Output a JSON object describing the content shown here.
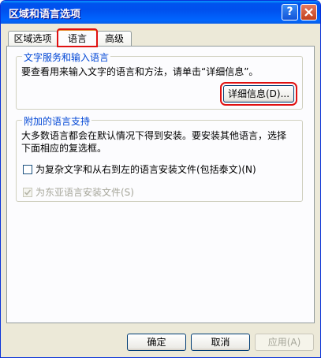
{
  "window": {
    "title": "区域和语言选项"
  },
  "titlebar": {
    "help_symbol": "?"
  },
  "tabs": [
    {
      "label": "区域选项"
    },
    {
      "label": "语言",
      "selected": true
    },
    {
      "label": "高级"
    }
  ],
  "text_services": {
    "legend": "文字服务和输入语言",
    "description": "要查看用来输入文字的语言和方法，请单击“详细信息”。",
    "details_button": "详细信息(D)..."
  },
  "supplemental": {
    "legend": "附加的语言支持",
    "description_line1": "大多数语言都会在默认情况下得到安装。要安装其他语言，选择",
    "description_line2": "下面相应的复选框。",
    "checkbox_complex": {
      "label": "为复杂文字和从右到左的语言安装文件(包括泰文)(N)",
      "checked": false,
      "enabled": true
    },
    "checkbox_east_asian": {
      "label": "为东亚语言安装文件(S)",
      "checked": true,
      "enabled": false
    }
  },
  "footer": {
    "ok": "确定",
    "cancel": "取消",
    "apply": "应用(A)"
  },
  "colors": {
    "titlebar": "#0053ee",
    "highlight_outline": "#e01010",
    "legend_text": "#0046d5"
  }
}
